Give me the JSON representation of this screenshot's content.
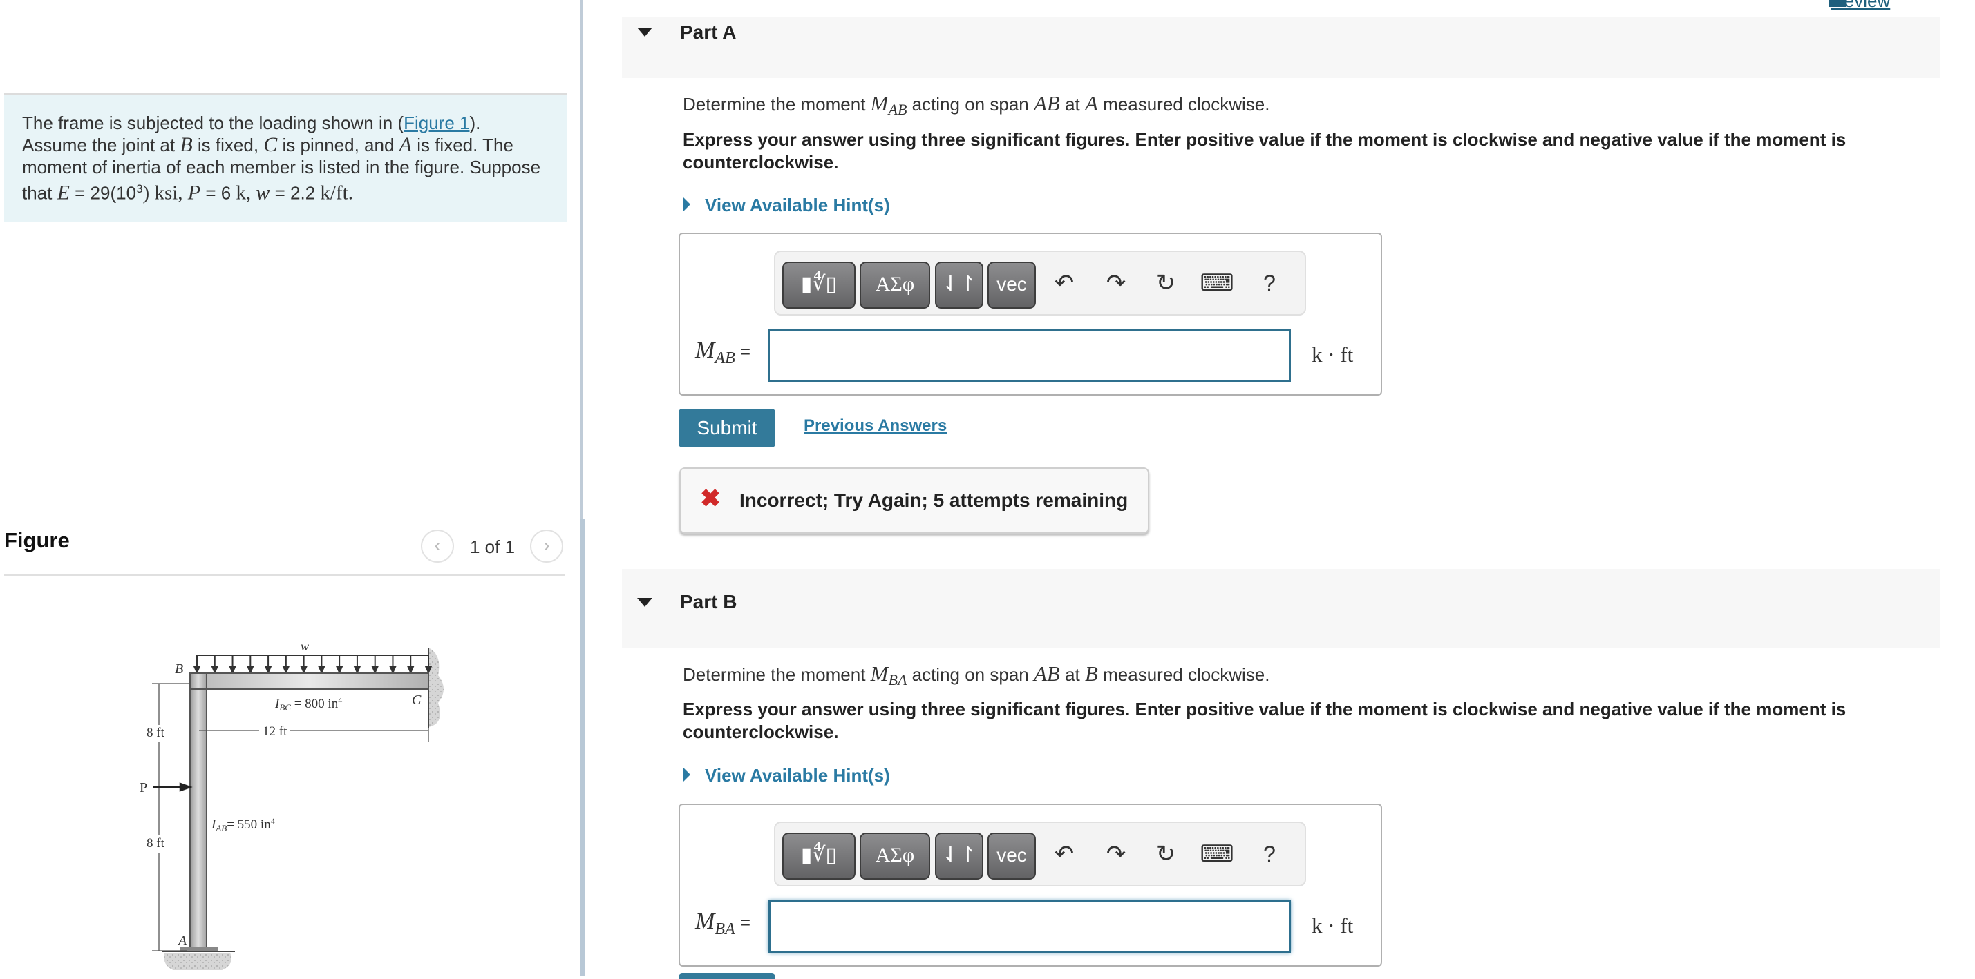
{
  "problem": {
    "text_1": "The frame is subjected to the loading shown in (",
    "figure_link": "Figure 1",
    "text_2": ").",
    "text_3": "Assume the joint at ",
    "B": "B",
    "text_4": " is fixed, ",
    "C": "C",
    "text_5": " is pinned, and ",
    "A": "A",
    "text_6": " is fixed. The moment of inertia of each member is listed in the figure. Suppose that ",
    "E_sym": "E",
    "E_val": " = 29(10",
    "E_exp": "3",
    "E_unit": ") ksi,",
    "P_sym": "P",
    "P_val": " = 6 ",
    "P_unit": "k,",
    "w_sym": "w",
    "w_val": " = 2.2 ",
    "w_unit": "k/ft."
  },
  "figure": {
    "title": "Figure",
    "pager": "1 of 1",
    "prev_icon": "chevron-left-icon",
    "next_icon": "chevron-right-icon",
    "labels": {
      "w": "w",
      "B": "B",
      "C": "C",
      "A": "A",
      "P": "P",
      "I_BC": "I",
      "I_BC_sub": "BC",
      "I_BC_val": " = 800 in",
      "I_BC_exp": "4",
      "I_AB": "I",
      "I_AB_sub": "AB",
      "I_AB_val": "= 550 in",
      "I_AB_exp": "4",
      "span_BC": "12 ft",
      "upper_height": "8 ft",
      "lower_height": "8 ft"
    }
  },
  "header": {
    "review_label": "Review",
    "review_icon": "book-icon"
  },
  "parts": [
    {
      "title": "Part A",
      "q_1": "Determine the moment ",
      "q_sym": "M",
      "q_sub": "AB",
      "q_2": " acting on span ",
      "q_span": "AB",
      "q_3": " at ",
      "q_point": "A",
      "q_4": " measured clockwise.",
      "instructions": "Express your answer using three significant figures. Enter positive value if the moment is clockwise and negative value if the moment is counterclockwise.",
      "hint_label": "View Available Hint(s)",
      "answer_label": "M",
      "answer_sub": "AB",
      "answer_eq": " =",
      "answer_value": "",
      "answer_unit": "k · ft",
      "submit_label": "Submit",
      "previous_answers_label": "Previous Answers",
      "feedback_icon": "✖",
      "feedback_text": "Incorrect; Try Again; 5 attempts remaining"
    },
    {
      "title": "Part B",
      "q_1": "Determine the moment ",
      "q_sym": "M",
      "q_sub": "BA",
      "q_2": " acting on span ",
      "q_span": "AB",
      "q_3": " at ",
      "q_point": "B",
      "q_4": " measured clockwise.",
      "instructions": "Express your answer using three significant figures. Enter positive value if the moment is clockwise and negative value if the moment is counterclockwise.",
      "hint_label": "View Available Hint(s)",
      "answer_label": "M",
      "answer_sub": "BA",
      "answer_eq": " =",
      "answer_value": "",
      "answer_unit": "k · ft"
    }
  ],
  "toolbar": {
    "templates_label": "▮∜▯",
    "greek_label": "ΑΣφ",
    "arrows_label": "⇃↾",
    "vec_label": "vec",
    "undo_glyph": "↶",
    "redo_glyph": "↷",
    "reset_glyph": "↻",
    "keyboard_glyph": "⌨",
    "help_glyph": "?"
  },
  "colors": {
    "accent": "#337a9a",
    "link": "#2a7aa3",
    "error": "#d12a2a",
    "problem_bg": "#e8f4f7",
    "part_header_bg": "#f7f7f7"
  }
}
